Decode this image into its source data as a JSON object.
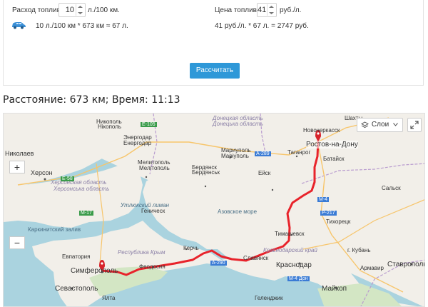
{
  "calculator": {
    "fuel_consumption_label": "Расход топлива",
    "fuel_consumption_value": "10",
    "fuel_consumption_unit": "л./100 км.",
    "fuel_price_label": "Цена топлива",
    "fuel_price_value": "41",
    "fuel_price_unit": "руб./л.",
    "fuel_formula": "10 л./100 км * 673 км ≈ 67 л.",
    "cost_formula": "41 руб./л. * 67 л. = 2747 руб.",
    "calculate_button": "Рассчитать",
    "car_icon": "car-icon"
  },
  "summary": "Расстояние: 673 км; Время: 11:13",
  "map": {
    "zoom_in": "+",
    "zoom_out": "−",
    "layers_label": "Слои",
    "places": {
      "nikolaev": "Николаев",
      "kherson": "Херсон",
      "kherson_region": "Херсонская область",
      "kherson_region_ukr": "Херсонська область",
      "melitopol": "Мелитополь",
      "melitopol_ukr": "Мелітополь",
      "energodar": "Энергодар",
      "energodar_ukr": "Енергодар",
      "nikopol": "Никополь",
      "nikopol_ukr": "Нікополь",
      "donetsk_region": "Донецкая область",
      "donetsk_region_ukr": "Донецька область",
      "mariupol": "Мариуполь",
      "mariupol_ukr": "Маріуполь",
      "berdyansk": "Бердянск",
      "berdyansk_ukr": "Бердянськ",
      "taganrog": "Таганрог",
      "rostov": "Ростов-на-Дону",
      "novocherkassk": "Новочеркасск",
      "shakhty": "Шахты",
      "bataysk": "Батайск",
      "eysk": "Ейск",
      "azov_sea": "Азовское море",
      "utlyuk": "Утлюкский лиман",
      "genichesk": "Геническ",
      "karkinit": "Каркинитский залив",
      "crimea": "Республика Крым",
      "evpatoria": "Евпатория",
      "simferopol": "Симферополь",
      "sevastopol": "Севастополь",
      "yalta": "Ялта",
      "feodosia": "Феодосия",
      "kerch": "Керчь",
      "krasnodar_krai": "Краснодарский край",
      "krasnodar": "Краснодар",
      "timashevsk": "Тимашевск",
      "tikhoretsk": "Тихорецк",
      "kropotkin": "г. Кубань",
      "armavir": "Армавир",
      "stavropol": "Ставрополь",
      "maikop": "Майкоп",
      "gelendzhik": "Геленджик",
      "salsk": "Сальск",
      "slavyansk": "Славянск",
      "road_e58": "E-58",
      "road_m17": "M-17",
      "road_e105": "E-105",
      "road_m4": "M-4",
      "road_p217": "P-217",
      "road_a290": "A-290",
      "road_a289": "A-289",
      "road_m4b": "M-4 Дон"
    }
  },
  "colors": {
    "button": "#2e98d8",
    "route": "#e8232b",
    "marker": "#d8232b",
    "sea": "#aad3df",
    "land": "#f2efe9"
  }
}
